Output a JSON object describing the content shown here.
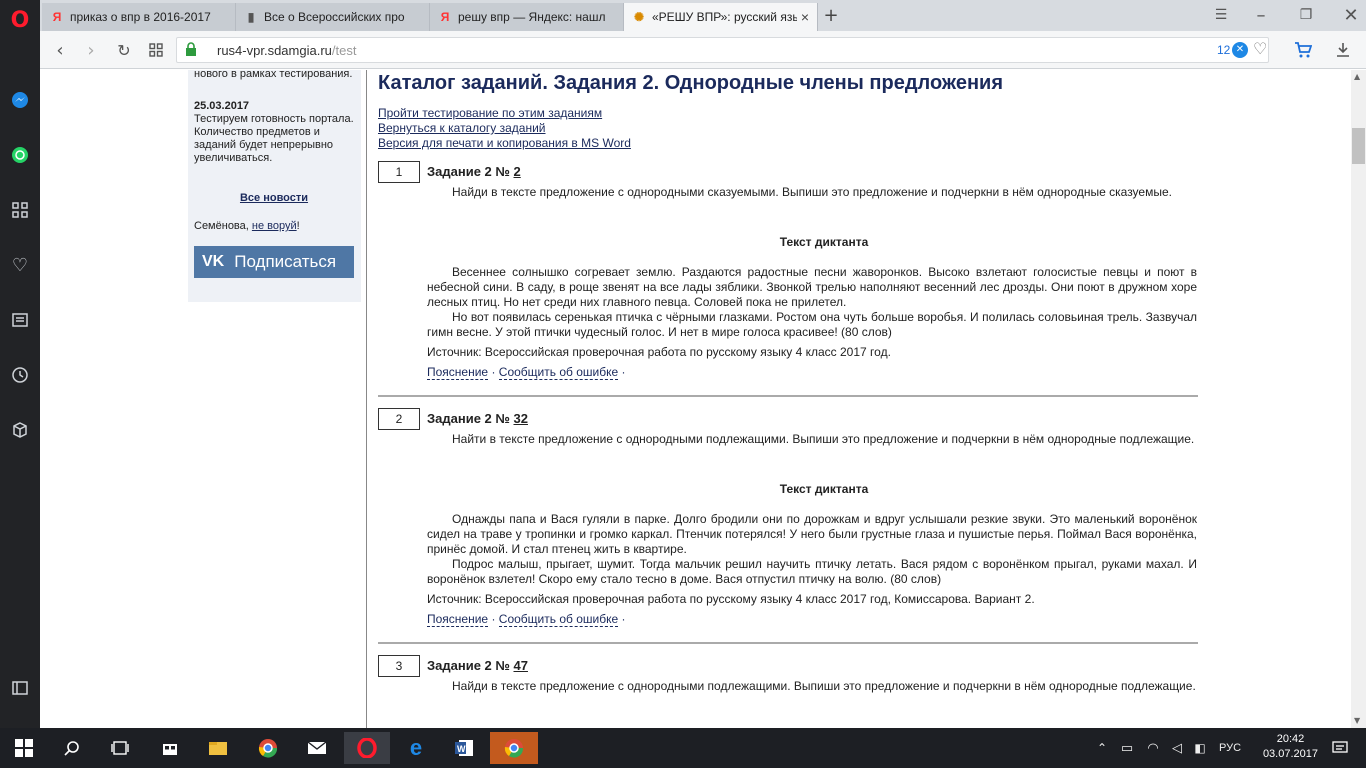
{
  "browser": {
    "tabs": [
      {
        "title": "приказ о впр в 2016-2017",
        "icon": "yandex-icon"
      },
      {
        "title": "Все о Всероссийских про",
        "icon": "document-icon"
      },
      {
        "title": "решу впр — Яндекс: нашл",
        "icon": "yandex-icon"
      },
      {
        "title": "«РЕШУ ВПР»: русский язык",
        "icon": "sdamgia-icon"
      }
    ],
    "url_host": "rus4-vpr.sdamgia.ru",
    "url_path": "/test",
    "ad_badge_count": "12"
  },
  "sidebar": {
    "top_text": "  нового в рамках тестирования.",
    "news_date": "25.03.2017",
    "news_text": "Тестируем готовность портала. Количество предметов и заданий будет непрерывно увеличиваться.",
    "all_news": "Все новости",
    "author_prefix": "Семёнова, ",
    "author_link": "не воруй",
    "author_suffix": "!",
    "vk_button": "Подписаться"
  },
  "main": {
    "title": "Каталог заданий. Задания 2. Однородные члены предложения",
    "links": [
      "Пройти тестирование по этим заданиям",
      "Вернуться к каталогу заданий",
      "Версия для печати и копирования в MS Word"
    ],
    "tasks": [
      {
        "index": "1",
        "head_prefix": "Задание 2 № ",
        "head_num": "2",
        "prompt": "Найди в тексте предложение с однородными сказуемыми. Выпиши это предложение и подчеркни в нём однородные сказуемые.",
        "dict_title": "Текст диктанта",
        "dict_p1": "Весеннее солнышко согревает землю. Раздаются радостные песни жаворонков. Высоко взлетают голосистые певцы и поют в небесной сини. В саду, в роще звенят на все лады зяблики. Звонкой трелью наполняют весенний лес дрозды. Они поют в дружном хоре лесных птиц. Но нет среди них главного певца. Соловей пока не прилетел.",
        "dict_p2": "Но вот появилась серенькая птичка с чёрными глазками. Ростом она чуть больше воробья. И полилась соловьиная трель. Зазвучал гимн весне. У этой птички чудесный голос. И нет в мире голоса красивее! (80 слов)",
        "source": "Источник: Всероссийская проверочная работа по русскому языку 4 класс 2017 год.",
        "link_explain": "Пояснение",
        "link_report": "Сообщить об ошибке"
      },
      {
        "index": "2",
        "head_prefix": "Задание 2 № ",
        "head_num": "32",
        "prompt": "Найти в тексте предложение с однородными подлежащими. Выпиши это предложение и подчеркни в нём однородные подлежащие.",
        "dict_title": "Текст диктанта",
        "dict_p1": "Однажды папа и Вася гуляли в парке. Долго бродили они по дорожкам и вдруг услышали резкие звуки. Это маленький воронёнок сидел на траве у тропинки и громко каркал. Птенчик потерялся! У него были грустные глаза и пушистые перья. Поймал Вася воронёнка, принёс домой. И стал птенец жить в квартире.",
        "dict_p2": "Подрос малыш, прыгает, шумит. Тогда мальчик решил научить птичку летать. Вася рядом с воронёнком прыгал, руками махал. И воронёнок взлетел! Скоро ему стало тесно в доме. Вася отпустил птичку на волю. (80 слов)",
        "source": "Источник: Всероссийская проверочная работа по русскому языку 4 класс 2017 год, Комиссарова. Вариант 2.",
        "link_explain": "Пояснение",
        "link_report": "Сообщить об ошибке"
      },
      {
        "index": "3",
        "head_prefix": "Задание 2 № ",
        "head_num": "47",
        "prompt": "Найди в тексте предложение с однородными подлежащими. Выпиши это предложение и подчеркни в нём однородные подлежащие."
      }
    ]
  },
  "taskbar": {
    "lang": "РУС",
    "time": "20:42",
    "date": "03.07.2017"
  }
}
